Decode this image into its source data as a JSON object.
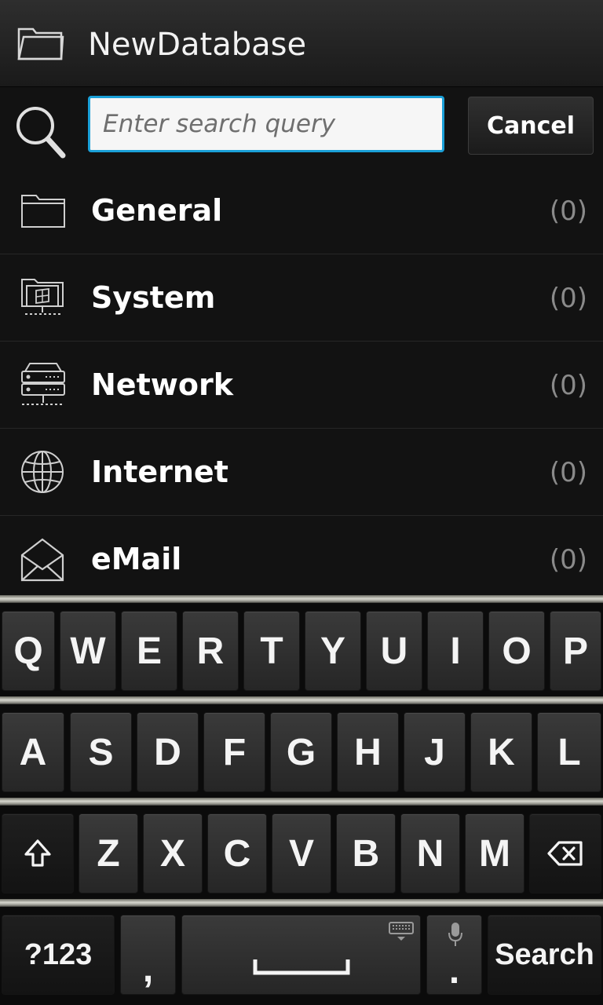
{
  "header": {
    "title": "NewDatabase",
    "icon": "folder-icon"
  },
  "search": {
    "placeholder": "Enter search query",
    "value": "",
    "cancel_label": "Cancel",
    "accent": "#1aa0d8"
  },
  "categories": [
    {
      "label": "General",
      "count": "(0)",
      "icon": "folder-icon"
    },
    {
      "label": "System",
      "count": "(0)",
      "icon": "system-folder-icon"
    },
    {
      "label": "Network",
      "count": "(0)",
      "icon": "server-icon"
    },
    {
      "label": "Internet",
      "count": "(0)",
      "icon": "globe-icon"
    },
    {
      "label": "eMail",
      "count": "(0)",
      "icon": "open-envelope-icon"
    }
  ],
  "keyboard": {
    "row1": [
      "Q",
      "W",
      "E",
      "R",
      "T",
      "Y",
      "U",
      "I",
      "O",
      "P"
    ],
    "row2": [
      "A",
      "S",
      "D",
      "F",
      "G",
      "H",
      "J",
      "K",
      "L"
    ],
    "row3": [
      "Z",
      "X",
      "C",
      "V",
      "B",
      "N",
      "M"
    ],
    "symbols_label": "?123",
    "comma_label": ",",
    "period_label": ".",
    "search_label": "Search"
  }
}
